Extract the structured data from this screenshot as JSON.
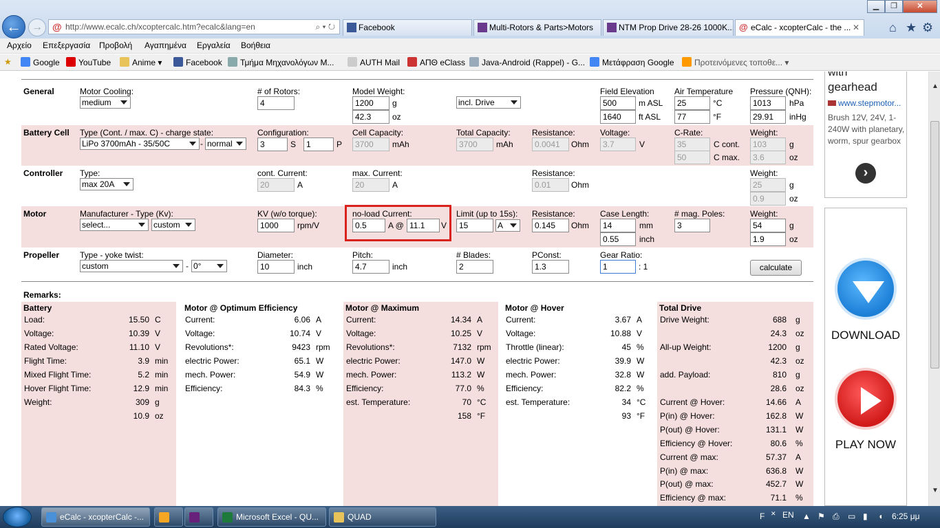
{
  "browser": {
    "address": "http://www.ecalc.ch/xcoptercalc.htm?ecalc&lang=en",
    "address_domain": "www.ecalc.ch",
    "tabs": [
      {
        "label": "Facebook"
      },
      {
        "label": "Multi-Rotors & Parts>Motors"
      },
      {
        "label": "NTM Prop Drive 28-26 1000K..."
      },
      {
        "label": "eCalc - xcopterCalc - the ..."
      }
    ],
    "menu": [
      "Αρχείο",
      "Επεξεργασία",
      "Προβολή",
      "Αγαπημένα",
      "Εργαλεία",
      "Βοήθεια"
    ],
    "favorites": [
      "Google",
      "YouTube",
      "Anime",
      "Facebook",
      "Τμήμα Μηχανολόγων Μ...",
      "AUTH Mail",
      "ΑΠΘ eClass",
      "Java-Android (Rappel) - G...",
      "Μετάφραση Google",
      "Προτεινόμενες τοποθε..."
    ]
  },
  "form": {
    "general": {
      "section": "General",
      "motor_cooling_label": "Motor Cooling:",
      "motor_cooling": "medium",
      "rotors_label": "# of Rotors:",
      "rotors": "4",
      "model_weight_label": "Model Weight:",
      "model_weight_g": "1200",
      "model_weight_oz": "42.3",
      "weight_mode": "incl. Drive",
      "field_elev_label": "Field Elevation",
      "field_elev_m": "500",
      "field_elev_ft": "1640",
      "air_temp_label": "Air Temperature",
      "air_temp_c": "25",
      "air_temp_f": "77",
      "pressure_label": "Pressure (QNH):",
      "pressure_hpa": "1013",
      "pressure_inhg": "29.91",
      "u_g": "g",
      "u_oz": "oz",
      "u_m": "m ASL",
      "u_ft": "ft ASL",
      "u_c": "°C",
      "u_f": "°F",
      "u_hpa": "hPa",
      "u_inhg": "inHg"
    },
    "battery": {
      "section": "Battery Cell",
      "type_label": "Type (Cont. / max. C) - charge state:",
      "type": "LiPo 3700mAh - 35/50C",
      "state": "normal",
      "config_label": "Configuration:",
      "s": "3",
      "p": "1",
      "u_s": "S",
      "u_p": "P",
      "cap_label": "Cell Capacity:",
      "cap": "3700",
      "u_mah": "mAh",
      "total_label": "Total Capacity:",
      "total": "3700",
      "res_label": "Resistance:",
      "res": "0.0041",
      "u_ohm": "Ohm",
      "volt_label": "Voltage:",
      "volt": "3.7",
      "u_v": "V",
      "crate_label": "C-Rate:",
      "c_cont": "35",
      "c_max": "50",
      "u_ccont": "C cont.",
      "u_cmax": "C max.",
      "weight_label": "Weight:",
      "weight_g": "103",
      "weight_oz": "3.6"
    },
    "controller": {
      "section": "Controller",
      "type_label": "Type:",
      "type": "max 20A",
      "cont_label": "cont. Current:",
      "cont": "20",
      "u_a": "A",
      "max_label": "max. Current:",
      "max": "20",
      "res_label": "Resistance:",
      "res": "0.01",
      "u_ohm": "Ohm",
      "weight_label": "Weight:",
      "weight_g": "25",
      "weight_oz": "0.9"
    },
    "motor": {
      "section": "Motor",
      "mfr_label": "Manufacturer - Type (Kv):",
      "mfr": "select...",
      "mtype": "custom",
      "kv_label": "KV (w/o torque):",
      "kv": "1000",
      "u_kv": "rpm/V",
      "noload_label": "no-load Current:",
      "noload_a": "0.5",
      "noload_v": "11.1",
      "u_a_at": "A @",
      "u_v": "V",
      "limit_label": "Limit (up to 15s):",
      "limit": "15",
      "limit_unit": "A",
      "res_label": "Resistance:",
      "res": "0.145",
      "u_ohm": "Ohm",
      "case_label": "Case Length:",
      "case_mm": "14",
      "case_in": "0.55",
      "u_mm": "mm",
      "u_inch": "inch",
      "poles_label": "# mag. Poles:",
      "poles": "3",
      "weight_label": "Weight:",
      "weight_g": "54",
      "weight_oz": "1.9"
    },
    "propeller": {
      "section": "Propeller",
      "type_label": "Type - yoke twist:",
      "type": "custom",
      "twist": "0°",
      "diam_label": "Diameter:",
      "diam": "10",
      "u_inch": "inch",
      "pitch_label": "Pitch:",
      "pitch": "4.7",
      "blades_label": "# Blades:",
      "blades": "2",
      "pconst_label": "PConst:",
      "pconst": "1.3",
      "gear_label": "Gear Ratio:",
      "gear": "1",
      "gear_suffix": ": 1",
      "calc": "calculate"
    }
  },
  "remarks": {
    "title": "Remarks:",
    "battery": {
      "title": "Battery",
      "rows": [
        [
          "Load:",
          "15.50",
          "C"
        ],
        [
          "Voltage:",
          "10.39",
          "V"
        ],
        [
          "Rated Voltage:",
          "11.10",
          "V"
        ],
        [
          "Flight Time:",
          "3.9",
          "min"
        ],
        [
          "Mixed Flight Time:",
          "5.2",
          "min"
        ],
        [
          "Hover Flight Time:",
          "12.9",
          "min"
        ],
        [
          "Weight:",
          "309",
          "g"
        ],
        [
          "",
          "10.9",
          "oz"
        ]
      ]
    },
    "opt": {
      "title": "Motor @ Optimum Efficiency",
      "rows": [
        [
          "Current:",
          "6.06",
          "A"
        ],
        [
          "Voltage:",
          "10.74",
          "V"
        ],
        [
          "Revolutions*:",
          "9423",
          "rpm"
        ],
        [
          "electric Power:",
          "65.1",
          "W"
        ],
        [
          "mech. Power:",
          "54.9",
          "W"
        ],
        [
          "Efficiency:",
          "84.3",
          "%"
        ]
      ]
    },
    "max": {
      "title": "Motor @ Maximum",
      "rows": [
        [
          "Current:",
          "14.34",
          "A"
        ],
        [
          "Voltage:",
          "10.25",
          "V"
        ],
        [
          "Revolutions*:",
          "7132",
          "rpm"
        ],
        [
          "electric Power:",
          "147.0",
          "W"
        ],
        [
          "mech. Power:",
          "113.2",
          "W"
        ],
        [
          "Efficiency:",
          "77.0",
          "%"
        ],
        [
          "est. Temperature:",
          "70",
          "°C"
        ],
        [
          "",
          "158",
          "°F"
        ]
      ]
    },
    "hover": {
      "title": "Motor @ Hover",
      "rows": [
        [
          "Current:",
          "3.67",
          "A"
        ],
        [
          "Voltage:",
          "10.88",
          "V"
        ],
        [
          "Throttle (linear):",
          "45",
          "%"
        ],
        [
          "electric Power:",
          "39.9",
          "W"
        ],
        [
          "mech. Power:",
          "32.8",
          "W"
        ],
        [
          "Efficiency:",
          "82.2",
          "%"
        ],
        [
          "est. Temperature:",
          "34",
          "°C"
        ],
        [
          "",
          "93",
          "°F"
        ]
      ]
    },
    "total": {
      "title": "Total Drive",
      "rows": [
        [
          "Drive Weight:",
          "688",
          "g"
        ],
        [
          "",
          "24.3",
          "oz"
        ],
        [
          "All-up Weight:",
          "1200",
          "g"
        ],
        [
          "",
          "42.3",
          "oz"
        ],
        [
          "add. Payload:",
          "810",
          "g"
        ],
        [
          "",
          "28.6",
          "oz"
        ],
        [
          "Current @ Hover:",
          "14.66",
          "A"
        ],
        [
          "P(in) @ Hover:",
          "162.8",
          "W"
        ],
        [
          "P(out) @ Hover:",
          "131.1",
          "W"
        ],
        [
          "Efficiency @ Hover:",
          "80.6",
          "%"
        ],
        [
          "Current @ max:",
          "57.37",
          "A"
        ],
        [
          "P(in) @ max:",
          "636.8",
          "W"
        ],
        [
          "P(out) @ max:",
          "452.7",
          "W"
        ],
        [
          "Efficiency @ max:",
          "71.1",
          "%"
        ]
      ]
    }
  },
  "ad": {
    "line1": "with",
    "line2": "gearhead",
    "link": "www.stepmotor...",
    "desc": "Brush 12V, 24V, 1-240W with planetary, worm, spur gearbox",
    "download": "DOWNLOAD",
    "play": "PLAY NOW"
  },
  "taskbar": {
    "items": [
      "eCalc - xcopterCalc -...",
      "",
      "",
      "Microsoft Excel - QU...",
      "QUAD"
    ],
    "lang1": "F",
    "lang2": "EN",
    "time": "6:25 μμ"
  }
}
